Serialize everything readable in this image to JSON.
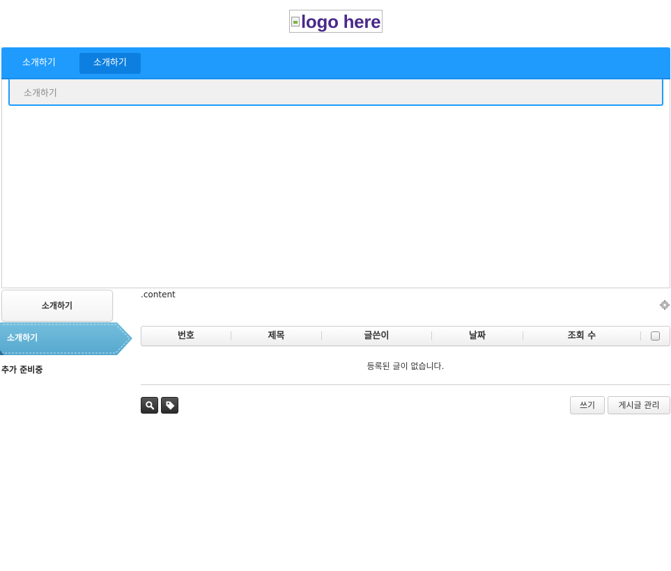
{
  "logo": {
    "alt_text": "logo here"
  },
  "gnb": {
    "items": [
      {
        "label": "소개하기"
      },
      {
        "label": "소개하기"
      }
    ],
    "sub_items": [
      {
        "label": "소개하기"
      }
    ],
    "colors": {
      "bar": "#1e9bfd",
      "active": "#0c7fe0"
    }
  },
  "sidebar": {
    "button_label": "소개하기",
    "active_item_label": "소개하기",
    "note": "추가 준비중"
  },
  "content": {
    "label": ".content",
    "settings_icon": "gear-icon",
    "table": {
      "columns": [
        "번호",
        "제목",
        "글쓴이",
        "날짜",
        "조회 수"
      ],
      "empty_message": "등록된 글이 없습니다."
    },
    "tools": {
      "search_icon": "search-icon",
      "tag_icon": "tag-icon"
    },
    "buttons": {
      "write": "쓰기",
      "manage": "게시글 관리"
    }
  }
}
